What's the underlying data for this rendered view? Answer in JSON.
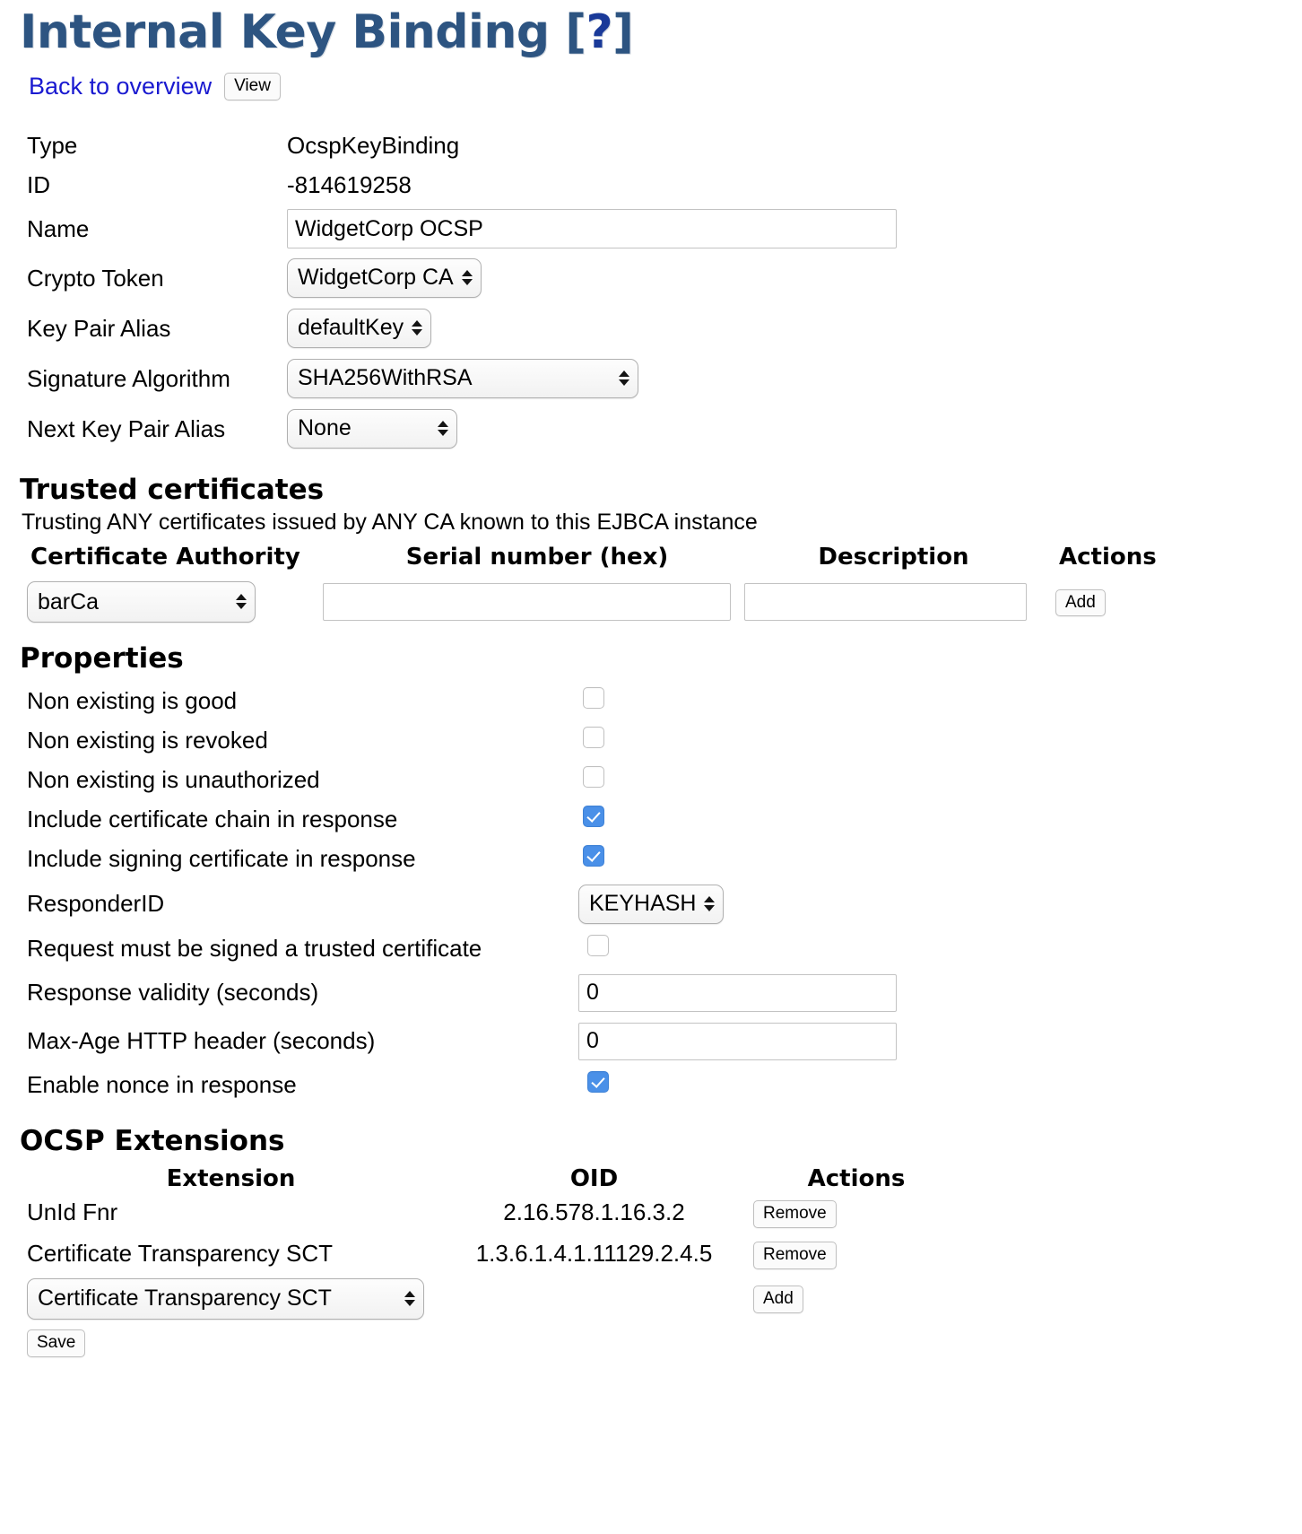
{
  "header": {
    "title_main": "Internal Key Binding [",
    "title_q": "?",
    "title_close": "]",
    "back_link": "Back to overview",
    "view_button": "View"
  },
  "details": {
    "type_label": "Type",
    "type_value": "OcspKeyBinding",
    "id_label": "ID",
    "id_value": "-814619258",
    "name_label": "Name",
    "name_value": "WidgetCorp OCSP",
    "crypto_token_label": "Crypto Token",
    "crypto_token_value": "WidgetCorp CA",
    "key_pair_alias_label": "Key Pair Alias",
    "key_pair_alias_value": "defaultKey",
    "signature_algorithm_label": "Signature Algorithm",
    "signature_algorithm_value": "SHA256WithRSA",
    "next_key_pair_alias_label": "Next Key Pair Alias",
    "next_key_pair_alias_value": "None"
  },
  "trusted_certificates": {
    "heading": "Trusted certificates",
    "subtitle": "Trusting ANY certificates issued by ANY CA known to this EJBCA instance",
    "columns": {
      "ca": "Certificate Authority",
      "serial": "Serial number (hex)",
      "description": "Description",
      "actions": "Actions"
    },
    "new_row": {
      "ca_value": "barCa",
      "serial_value": "",
      "serial_placeholder": "",
      "description_value": "",
      "description_placeholder": "",
      "add_button": "Add"
    }
  },
  "properties": {
    "heading": "Properties",
    "items": [
      {
        "label": "Non existing is good",
        "type": "checkbox",
        "checked": false
      },
      {
        "label": "Non existing is revoked",
        "type": "checkbox",
        "checked": false
      },
      {
        "label": "Non existing is unauthorized",
        "type": "checkbox",
        "checked": false
      },
      {
        "label": "Include certificate chain in response",
        "type": "checkbox",
        "checked": true
      },
      {
        "label": "Include signing certificate in response",
        "type": "checkbox",
        "checked": true
      },
      {
        "label": "ResponderID",
        "type": "select",
        "value": "KEYHASH"
      },
      {
        "label": "Request must be signed a trusted certificate",
        "type": "checkbox",
        "checked": false
      },
      {
        "label": "Response validity (seconds)",
        "type": "text",
        "value": "0"
      },
      {
        "label": "Max-Age HTTP header (seconds)",
        "type": "text",
        "value": "0"
      },
      {
        "label": "Enable nonce in response",
        "type": "checkbox",
        "checked": true
      }
    ]
  },
  "ocsp_extensions": {
    "heading": "OCSP Extensions",
    "columns": {
      "extension": "Extension",
      "oid": "OID",
      "actions": "Actions"
    },
    "rows": [
      {
        "extension": "UnId Fnr",
        "oid": "2.16.578.1.16.3.2",
        "action": "Remove"
      },
      {
        "extension": "Certificate Transparency SCT",
        "oid": "1.3.6.1.4.1.11129.2.4.5",
        "action": "Remove"
      }
    ],
    "new_row": {
      "select_value": "Certificate Transparency SCT",
      "add_button": "Add"
    }
  },
  "footer": {
    "save_button": "Save"
  },
  "colors": {
    "title": "#2d5481",
    "title_accent": "#1a3a99",
    "link": "#1a1ad0",
    "checkbox_checked": "#4a90e8"
  }
}
